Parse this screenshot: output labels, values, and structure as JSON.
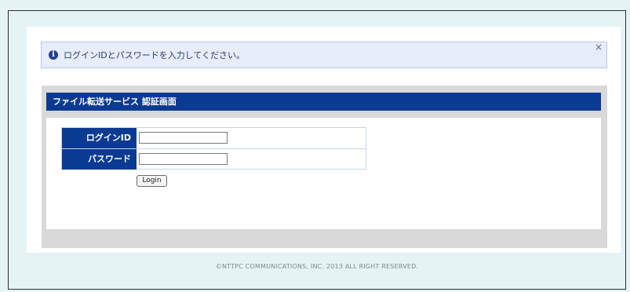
{
  "notice": {
    "icon": "info-icon",
    "icon_glyph": "i",
    "text": "ログインIDとパスワードを入力してください。",
    "close_glyph": "×"
  },
  "panel": {
    "title": "ファイル転送サービス 認証画面"
  },
  "form": {
    "login_id": {
      "label": "ログインID",
      "value": ""
    },
    "password": {
      "label": "パスワード",
      "value": ""
    },
    "submit_label": "Login"
  },
  "footer": {
    "copyright": "©NTTPC COMMUNICATIONS, INC. 2013 ALL RIGHT RESERVED."
  },
  "colors": {
    "page_background": "#e6f3f4",
    "brand_blue": "#0b3a93",
    "notice_background": "#e7edfb",
    "panel_gray": "#d9d9d9"
  }
}
